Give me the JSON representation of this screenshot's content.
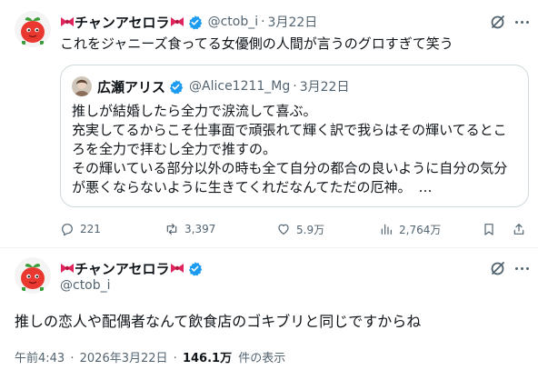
{
  "colors": {
    "text": "#0f1419",
    "muted": "#536471",
    "border": "#cfd9de",
    "verified_blue": "#1d9bf0",
    "bow_red": "#e0245e",
    "apple_red": "#e8382f"
  },
  "icons": {
    "bow": "ribbon-bow",
    "verified": "verified-badge",
    "grok": "grok-slash-icon",
    "more": "more-dots",
    "reply": "speech-bubble",
    "retweet": "retweet-arrows",
    "like": "heart",
    "views": "bar-chart",
    "bookmark": "bookmark",
    "share": "share-arrow"
  },
  "parent_tweet": {
    "display_name": "チャンアセロラ",
    "handle": "@ctob_i",
    "separator": "·",
    "timestamp": "3月22日",
    "text": "これをジャニーズ食ってる女優側の人間が言うのグロすぎて笑う",
    "quote": {
      "display_name": "広瀬アリス",
      "handle": "@Alice1211_Mg",
      "separator": "·",
      "timestamp": "3月22日",
      "lines": [
        "推しが結婚したら全力で涙流して喜ぶ。",
        "充実してるからこそ仕事面で頑張れて輝く訳で我らはその輝いてるとこ",
        "ろを全力で拝むし全力で推すの。",
        "その輝いている部分以外の時も全て自分の都合の良いように自分の気分",
        "が悪くならないように生きてくれだなんてただの厄神。"
      ],
      "ellipsis": "…"
    },
    "stats": {
      "replies": "221",
      "retweets": "3,397",
      "likes": "5.9万",
      "views": "2,764万"
    }
  },
  "main_tweet": {
    "display_name": "チャンアセロラ",
    "handle": "@ctob_i",
    "text": "推しの恋人や配偶者なんて飲食店のゴキブリと同じですからね",
    "time": "午前4:43",
    "separator": "·",
    "date": "2026年3月22日",
    "views_count": "146.1万",
    "views_label": "件の表示"
  }
}
